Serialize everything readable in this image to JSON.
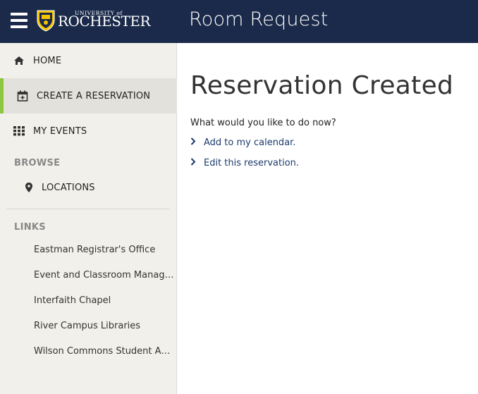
{
  "header": {
    "logo_small": "UNIVERSITY of",
    "logo_big": "ROCHESTER",
    "app_title": "Room Request"
  },
  "sidebar": {
    "nav": [
      {
        "label": "HOME",
        "icon": "home-icon"
      },
      {
        "label": "CREATE A RESERVATION",
        "icon": "calendar-plus-icon",
        "active": true
      },
      {
        "label": "MY EVENTS",
        "icon": "grid-icon"
      }
    ],
    "browse_title": "BROWSE",
    "browse": [
      {
        "label": "LOCATIONS",
        "icon": "map-pin-icon"
      }
    ],
    "links_title": "LINKS",
    "links": [
      "Eastman Registrar's Office",
      "Event and Classroom Management",
      "Interfaith Chapel",
      "River Campus Libraries",
      "Wilson Commons Student Activities"
    ]
  },
  "main": {
    "title": "Reservation Created",
    "prompt": "What would you like to do now?",
    "actions": [
      "Add to my calendar.",
      "Edit this reservation."
    ]
  },
  "colors": {
    "header_bg": "#1b2a4a",
    "sidebar_bg": "#f1f0ea",
    "active_accent": "#8dc63f",
    "link_color": "#1b3a6b"
  }
}
